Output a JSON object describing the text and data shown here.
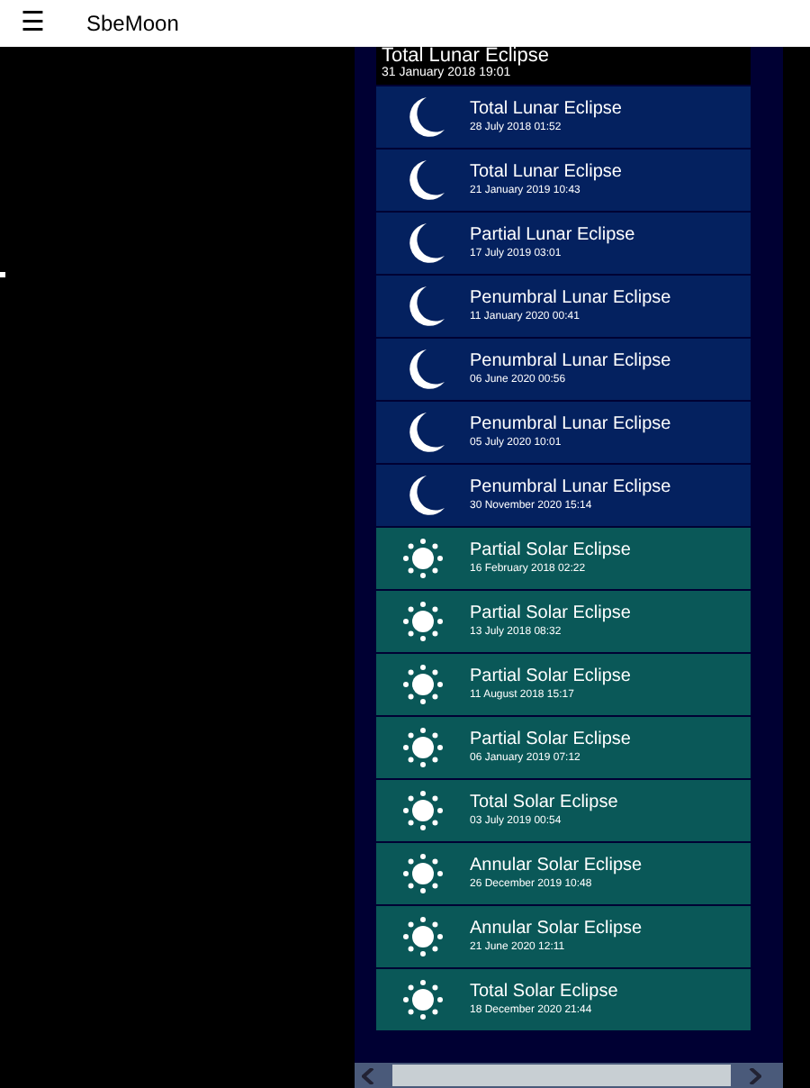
{
  "app_bar": {
    "menu_glyph": "☰",
    "title": "SbeMoon"
  },
  "eclipses": [
    {
      "title": "Total Lunar Eclipse",
      "date": "31 January 2018 19:01",
      "selected": true
    },
    {
      "kind": "lunar",
      "title": "Total Lunar Eclipse",
      "date": "28 July 2018 01:52",
      "selected": false
    },
    {
      "kind": "lunar",
      "title": "Total Lunar Eclipse",
      "date": "21 January 2019 10:43",
      "selected": false
    },
    {
      "kind": "lunar",
      "title": "Partial Lunar Eclipse",
      "date": "17 July 2019 03:01",
      "selected": false
    },
    {
      "kind": "lunar",
      "title": "Penumbral Lunar Eclipse",
      "date": "11 January 2020 00:41",
      "selected": false
    },
    {
      "kind": "lunar",
      "title": "Penumbral Lunar Eclipse",
      "date": "06 June 2020 00:56",
      "selected": false
    },
    {
      "kind": "lunar",
      "title": "Penumbral Lunar Eclipse",
      "date": "05 July 2020 10:01",
      "selected": false
    },
    {
      "kind": "lunar",
      "title": "Penumbral Lunar Eclipse",
      "date": "30 November 2020 15:14",
      "selected": false
    },
    {
      "kind": "solar",
      "title": "Partial Solar Eclipse",
      "date": "16 February 2018 02:22",
      "selected": false
    },
    {
      "kind": "solar",
      "title": "Partial Solar Eclipse",
      "date": "13 July 2018 08:32",
      "selected": false
    },
    {
      "kind": "solar",
      "title": "Partial Solar Eclipse",
      "date": "11 August 2018 15:17",
      "selected": false
    },
    {
      "kind": "solar",
      "title": "Partial Solar Eclipse",
      "date": "06 January 2019 07:12",
      "selected": false
    },
    {
      "kind": "solar",
      "title": "Total Solar Eclipse",
      "date": "03 July 2019 00:54",
      "selected": false
    },
    {
      "kind": "solar",
      "title": "Annular Solar Eclipse",
      "date": "26 December 2019 10:48",
      "selected": false
    },
    {
      "kind": "solar",
      "title": "Annular Solar Eclipse",
      "date": "21 June 2020 12:11",
      "selected": false
    },
    {
      "kind": "solar",
      "title": "Total Solar Eclipse",
      "date": "18 December 2020 21:44",
      "selected": false
    }
  ]
}
